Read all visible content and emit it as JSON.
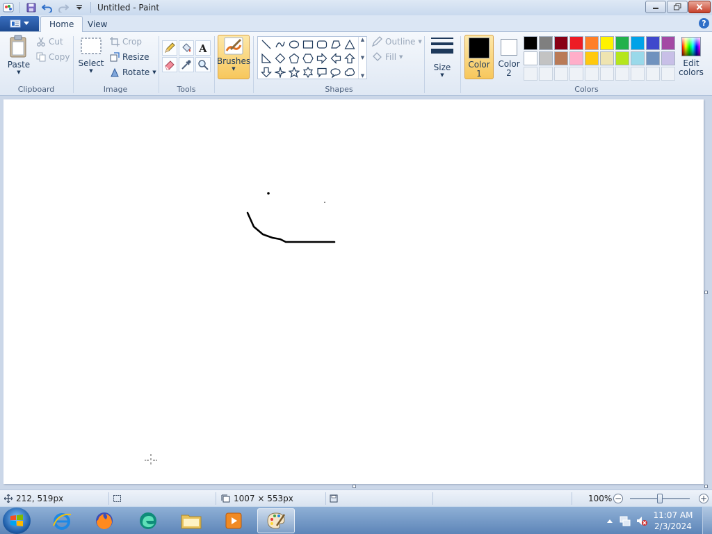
{
  "window": {
    "title": "Untitled - Paint"
  },
  "tabs": {
    "home": "Home",
    "view": "View"
  },
  "clipboard": {
    "paste": "Paste",
    "cut": "Cut",
    "copy": "Copy",
    "group_label": "Clipboard"
  },
  "image": {
    "select": "Select",
    "crop": "Crop",
    "resize": "Resize",
    "rotate": "Rotate",
    "group_label": "Image"
  },
  "tools": {
    "group_label": "Tools"
  },
  "brushes": {
    "label": "Brushes"
  },
  "shapes": {
    "outline": "Outline",
    "fill": "Fill",
    "group_label": "Shapes"
  },
  "size": {
    "label": "Size"
  },
  "colors": {
    "color1_label": "Color 1",
    "color2_label": "Color 2",
    "edit_label": "Edit colors",
    "group_label": "Colors",
    "color1": "#000000",
    "color2": "#ffffff",
    "palette_row1": [
      "#000000",
      "#7f7f7f",
      "#880015",
      "#ed1c24",
      "#ff7f27",
      "#fff200",
      "#22b14c",
      "#00a2e8",
      "#3f48cc",
      "#a349a4"
    ],
    "palette_row2": [
      "#ffffff",
      "#c3c3c3",
      "#b97a57",
      "#ffaec9",
      "#ffc90e",
      "#efe4b0",
      "#b5e61d",
      "#99d9ea",
      "#7092be",
      "#c8bfe7"
    ]
  },
  "status": {
    "cursor_pos": "212, 519px",
    "canvas_size": "1007 × 553px",
    "zoom": "100%",
    "zoom_fraction": 0.5
  },
  "taskbar": {
    "time": "11:07 AM",
    "date": "2/3/2024"
  },
  "accent": {
    "ribbon_active": "#f7c75c",
    "stroke": "#000000"
  }
}
